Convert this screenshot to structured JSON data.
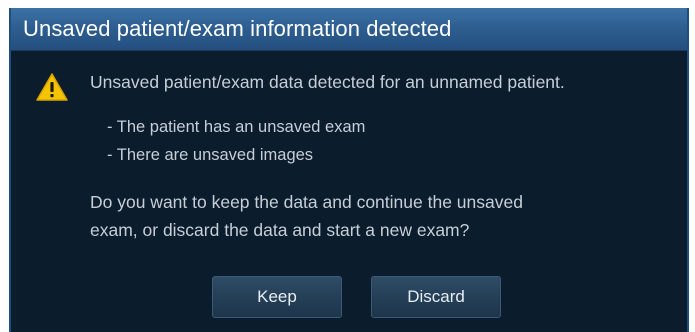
{
  "dialog": {
    "title": "Unsaved patient/exam information detected",
    "message": "Unsaved patient/exam data detected for an unnamed patient.",
    "bullets": [
      "- The patient has an unsaved exam",
      "- There are unsaved images"
    ],
    "question_lines": [
      "Do you want to keep the data and continue the unsaved",
      "exam, or discard the data and start a new exam?"
    ],
    "buttons": {
      "keep": "Keep",
      "discard": "Discard"
    },
    "icon": "warning-triangle-icon"
  },
  "colors": {
    "title_bar": "#2e5f91",
    "background": "#0b1c2c",
    "text": "#c6ced7",
    "button": "#253f57",
    "warning_yellow": "#f5c400"
  }
}
